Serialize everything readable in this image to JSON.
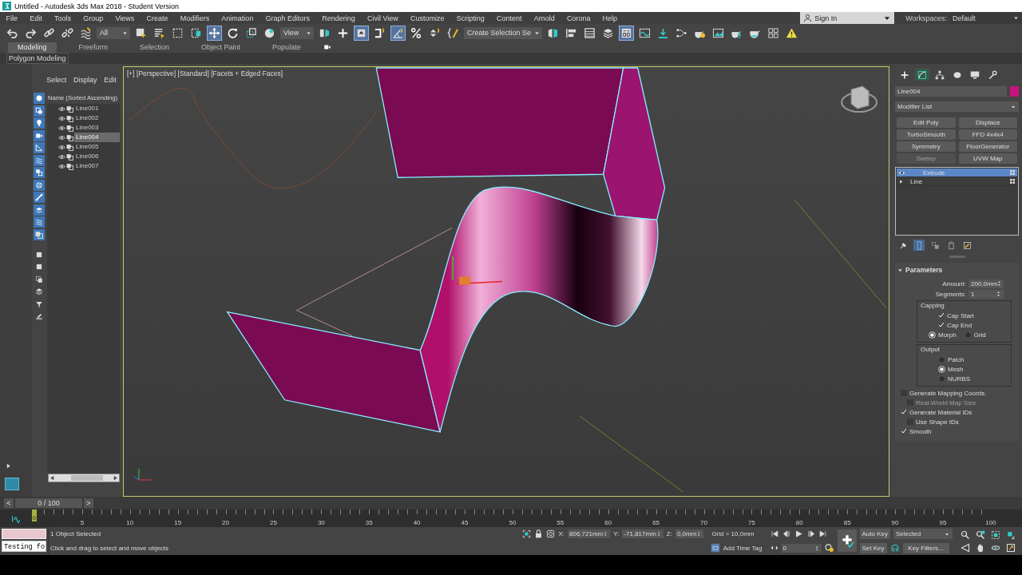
{
  "window": {
    "title": "Untitled - Autodesk 3ds Max 2018 - Student Version"
  },
  "menu": [
    "File",
    "Edit",
    "Tools",
    "Group",
    "Views",
    "Create",
    "Modifiers",
    "Animation",
    "Graph Editors",
    "Rendering",
    "Civil View",
    "Customize",
    "Scripting",
    "Content",
    "Arnold",
    "Corona",
    "Help"
  ],
  "account": {
    "sign_in": "Sign In",
    "workspaces_label": "Workspaces:",
    "workspace": "Default"
  },
  "main_toolbar": [
    {
      "kind": "icon",
      "selected": false
    },
    {
      "kind": "icon",
      "selected": false
    },
    {
      "kind": "icon",
      "selected": false
    },
    {
      "kind": "icon",
      "selected": false
    },
    {
      "kind": "icon",
      "selected": false
    },
    {
      "kind": "dropdown",
      "value": "All"
    },
    {
      "kind": "icon",
      "selected": false
    },
    {
      "kind": "icon",
      "selected": false
    },
    {
      "kind": "icon",
      "selected": false
    },
    {
      "kind": "icon",
      "selected": false
    },
    {
      "kind": "icon",
      "selected": true
    },
    {
      "kind": "icon",
      "selected": false
    },
    {
      "kind": "icon",
      "selected": false
    },
    {
      "kind": "icon",
      "selected": false
    },
    {
      "kind": "dropdown",
      "value": "View"
    },
    {
      "kind": "icon",
      "selected": false
    },
    {
      "kind": "icon",
      "selected": false
    },
    {
      "kind": "icon",
      "selected": true
    },
    {
      "kind": "icon",
      "selected": false
    },
    {
      "kind": "icon",
      "selected": true
    },
    {
      "kind": "icon",
      "selected": false
    },
    {
      "kind": "icon",
      "selected": false
    },
    {
      "kind": "icon",
      "selected": false
    },
    {
      "kind": "dropdown",
      "value": "Create Selection Se"
    },
    {
      "kind": "icon",
      "selected": false
    },
    {
      "kind": "icon",
      "selected": false
    },
    {
      "kind": "icon",
      "selected": false
    },
    {
      "kind": "icon",
      "selected": false
    },
    {
      "kind": "icon",
      "selected": true
    },
    {
      "kind": "icon",
      "selected": false
    },
    {
      "kind": "icon",
      "selected": false
    },
    {
      "kind": "icon",
      "selected": false
    },
    {
      "kind": "icon",
      "selected": false
    },
    {
      "kind": "icon",
      "selected": false
    },
    {
      "kind": "icon",
      "selected": false
    },
    {
      "kind": "icon",
      "selected": false
    },
    {
      "kind": "icon",
      "selected": false
    },
    {
      "kind": "icon",
      "selected": false
    }
  ],
  "ribbon": {
    "tabs": [
      {
        "label": "Modeling",
        "selected": true
      },
      {
        "label": "Freeform",
        "selected": false
      },
      {
        "label": "Selection",
        "selected": false
      },
      {
        "label": "Object Paint",
        "selected": false
      },
      {
        "label": "Populate",
        "selected": false
      }
    ],
    "panel": "Polygon Modeling"
  },
  "explorer": {
    "tabs": [
      "Select",
      "Display",
      "Edit"
    ],
    "header": "Name (Sorted Ascending)",
    "filters": [
      {
        "on": true
      },
      {
        "on": true
      },
      {
        "on": true
      },
      {
        "on": true
      },
      {
        "on": true
      },
      {
        "on": true
      },
      {
        "on": true
      },
      {
        "on": true
      },
      {
        "on": true
      },
      {
        "on": true
      },
      {
        "on": true
      },
      {
        "on": true
      }
    ],
    "objects": [
      {
        "name": "Line001",
        "selected": false
      },
      {
        "name": "Line002",
        "selected": false
      },
      {
        "name": "Line003",
        "selected": false
      },
      {
        "name": "Line004",
        "selected": true
      },
      {
        "name": "Line005",
        "selected": false
      },
      {
        "name": "Line006",
        "selected": false
      },
      {
        "name": "Line007",
        "selected": false
      }
    ]
  },
  "viewport": {
    "label": "[+] [Perspective] [Standard] [Facets + Edged Faces]"
  },
  "command_panel": {
    "tabs": [
      {
        "selected": false
      },
      {
        "selected": true
      },
      {
        "selected": false
      },
      {
        "selected": false
      },
      {
        "selected": false
      },
      {
        "selected": false
      }
    ],
    "object_name": "Line004",
    "modifier_list": "Modifier List",
    "modifier_buttons": [
      {
        "label": "Edit Poly",
        "disabled": false
      },
      {
        "label": "Displace",
        "disabled": false
      },
      {
        "label": "TurboSmooth",
        "disabled": false
      },
      {
        "label": "FFD 4x4x4",
        "disabled": false
      },
      {
        "label": "Symmetry",
        "disabled": false
      },
      {
        "label": "FloorGenerator",
        "disabled": false
      },
      {
        "label": "Sweep",
        "disabled": true
      },
      {
        "label": "UVW Map",
        "disabled": false
      }
    ],
    "stack": [
      {
        "name": "Extrude",
        "kind": "modifier",
        "selected": true
      },
      {
        "name": "Line",
        "kind": "object",
        "selected": false
      }
    ],
    "stack_tools": [
      {
        "selected": false
      },
      {
        "selected": true
      },
      {
        "selected": false
      },
      {
        "selected": false
      },
      {
        "selected": false
      }
    ],
    "parameters": {
      "title": "Parameters",
      "amount": {
        "label": "Amount:",
        "value": "200,0mm"
      },
      "segments": {
        "label": "Segments:",
        "value": "1"
      },
      "capping": {
        "title": "Capping",
        "checks": [
          {
            "label": "Cap Start",
            "checked": true
          },
          {
            "label": "Cap End",
            "checked": true
          }
        ],
        "options": [
          {
            "label": "Morph",
            "selected": true
          },
          {
            "label": "Grid",
            "selected": false
          }
        ]
      },
      "output": {
        "title": "Output",
        "options": [
          {
            "label": "Patch",
            "selected": false
          },
          {
            "label": "Mesh",
            "selected": true
          },
          {
            "label": "NURBS",
            "selected": false
          }
        ]
      },
      "checks": [
        {
          "label": "Generate Mapping Coords.",
          "checked": false,
          "disabled": false,
          "children": [
            {
              "label": "Real-World Map Size",
              "checked": false,
              "disabled": true
            }
          ]
        },
        {
          "label": "Generate Material IDs",
          "checked": true,
          "disabled": false,
          "children": [
            {
              "label": "Use Shape IDs",
              "checked": false,
              "disabled": false
            }
          ]
        },
        {
          "label": "Smooth",
          "checked": true,
          "disabled": false
        }
      ]
    }
  },
  "timeline": {
    "prev": "<",
    "next": ">",
    "frame_counter": "0 / 100",
    "level": 0,
    "current": "0",
    "labels": [
      "5",
      "10",
      "15",
      "20",
      "25",
      "30",
      "35",
      "40",
      "45",
      "50",
      "55",
      "60",
      "65",
      "70",
      "75",
      "80",
      "85",
      "90",
      "95",
      "100"
    ]
  },
  "status": {
    "listener_input": "Testing fo",
    "selection": "1 Object Selected",
    "prompt": "Click and drag to select and move objects",
    "x_label": "X:",
    "x": "806,721mm",
    "y_label": "Y:",
    "y": "-71,817mm",
    "z_label": "Z:",
    "z": "0,0mm",
    "grid": "Grid = 10,0mm",
    "time_tag": "Add Time Tag",
    "frame": "0",
    "auto_key": "Auto Key",
    "key_mode": "Selected",
    "set_key": "Set Key",
    "key_filters": "Key Filters..."
  }
}
